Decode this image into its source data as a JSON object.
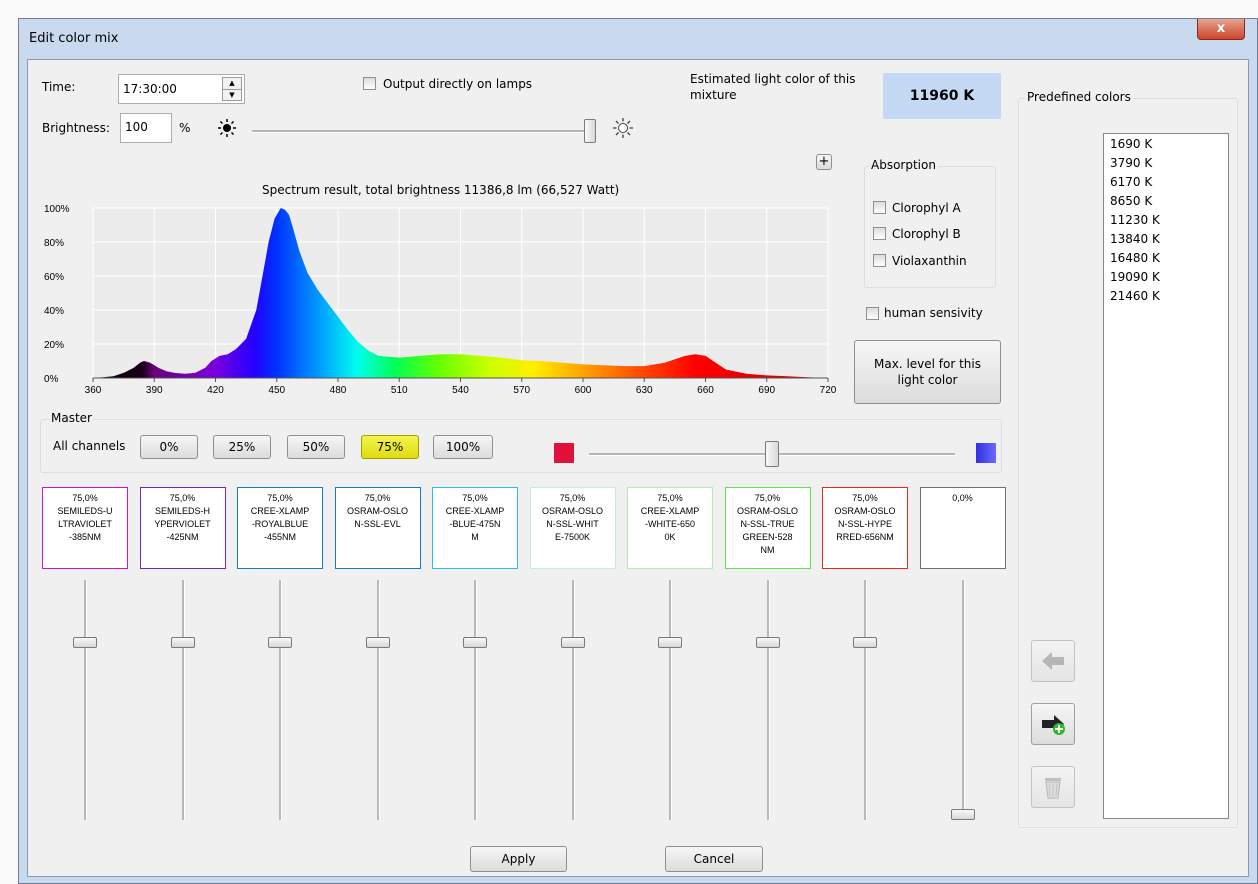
{
  "window": {
    "title": "Edit color mix",
    "close_glyph": "x"
  },
  "time": {
    "label": "Time:",
    "value": "17:30:00"
  },
  "output_lamps": {
    "label": "Output directly on lamps",
    "checked": false
  },
  "estimate": {
    "label": "Estimated light color of this mixture",
    "value": "11960 K",
    "color": "#c6d9f4"
  },
  "brightness": {
    "label": "Brightness:",
    "value": "100",
    "unit": "%",
    "slider_fraction": 1.0
  },
  "plus_label": "+",
  "chart_title": "Spectrum result, total brightness 11386,8 lm (66,527 Watt)",
  "absorption": {
    "title": "Absorption",
    "items": [
      {
        "label": "Clorophyl A",
        "checked": false
      },
      {
        "label": "Clorophyl B",
        "checked": false
      },
      {
        "label": "Violaxanthin",
        "checked": false
      }
    ]
  },
  "human_sensivity": {
    "label": "human sensivity",
    "checked": false
  },
  "max_level_button": {
    "line1": "Max. level for this",
    "line2": "light color"
  },
  "master": {
    "title": "Master",
    "all_channels_label": "All channels",
    "buttons": [
      {
        "label": "0%",
        "active": false
      },
      {
        "label": "25%",
        "active": false
      },
      {
        "label": "50%",
        "active": false
      },
      {
        "label": "75%",
        "active": true
      },
      {
        "label": "100%",
        "active": false
      }
    ],
    "slider_fraction": 0.5,
    "left_color": "#e0103a",
    "right_color": "#3030e0"
  },
  "channels": [
    {
      "value": "75,0%",
      "name_lines": [
        "SEMILEDS-U",
        "LTRAVIOLET",
        "-385NM"
      ],
      "color": "#c419c4",
      "level": 0.75
    },
    {
      "value": "75,0%",
      "name_lines": [
        "SEMILEDS-H",
        "YPERVIOLET",
        "-425NM"
      ],
      "color": "#7a1fc0",
      "level": 0.75
    },
    {
      "value": "75,0%",
      "name_lines": [
        "CREE-XLAMP",
        "-ROYALBLUE",
        "-455NM"
      ],
      "color": "#1b75cc",
      "level": 0.75
    },
    {
      "value": "75,0%",
      "name_lines": [
        "OSRAM-OSLO",
        "N-SSL-EVL"
      ],
      "color": "#1b75cc",
      "level": 0.75
    },
    {
      "value": "75,0%",
      "name_lines": [
        "CREE-XLAMP",
        "-BLUE-475N",
        "M"
      ],
      "color": "#30bde0",
      "level": 0.75
    },
    {
      "value": "75,0%",
      "name_lines": [
        "OSRAM-OSLO",
        "N-SSL-WHIT",
        "E-7500K"
      ],
      "color": "#c7ecd0",
      "level": 0.75
    },
    {
      "value": "75,0%",
      "name_lines": [
        "CREE-XLAMP",
        "-WHITE-650",
        "0K"
      ],
      "color": "#b2ecb8",
      "level": 0.75
    },
    {
      "value": "75,0%",
      "name_lines": [
        "OSRAM-OSLO",
        "N-SSL-TRUE",
        "GREEN-528",
        "NM"
      ],
      "color": "#5ee04a",
      "level": 0.75
    },
    {
      "value": "75,0%",
      "name_lines": [
        "OSRAM-OSLO",
        "N-SSL-HYPE",
        "RRED-656NM"
      ],
      "color": "#e02a1a",
      "level": 0.75
    },
    {
      "value": "0,0%",
      "name_lines": [],
      "color": "#707070",
      "level": 0.0
    }
  ],
  "predefined": {
    "title": "Predefined colors",
    "items": [
      "1690 K",
      "3790 K",
      "6170 K",
      "8650 K",
      "11230 K",
      "13840 K",
      "16480 K",
      "19090 K",
      "21460 K"
    ]
  },
  "side_icons": [
    "arrow-left-icon",
    "arrow-right-add-icon",
    "trash-icon"
  ],
  "apply_label": "Apply",
  "cancel_label": "Cancel",
  "chart_data": {
    "type": "area",
    "title": "Spectrum result, total brightness 11386,8 lm (66,527 Watt)",
    "xlabel": "",
    "ylabel": "",
    "xlim": [
      360,
      720
    ],
    "ylim": [
      0,
      100
    ],
    "x_ticks": [
      360,
      390,
      420,
      450,
      480,
      510,
      540,
      570,
      600,
      630,
      660,
      690,
      720
    ],
    "y_ticks": [
      "0%",
      "20%",
      "40%",
      "60%",
      "80%",
      "100%"
    ],
    "grid": true,
    "x": [
      360,
      365,
      370,
      375,
      380,
      383,
      385,
      388,
      392,
      396,
      400,
      405,
      410,
      415,
      418,
      422,
      426,
      430,
      435,
      440,
      443,
      446,
      449,
      452,
      454,
      456,
      458,
      461,
      465,
      470,
      475,
      480,
      485,
      490,
      495,
      500,
      510,
      520,
      530,
      540,
      550,
      560,
      570,
      580,
      590,
      600,
      610,
      620,
      630,
      640,
      645,
      650,
      655,
      660,
      665,
      670,
      680,
      690,
      700,
      710,
      720
    ],
    "y": [
      0,
      0.5,
      1,
      3,
      6,
      9,
      10,
      9,
      6,
      4,
      3,
      2.5,
      3,
      6,
      10,
      13,
      14,
      17,
      23,
      40,
      60,
      80,
      94,
      100,
      99,
      96,
      88,
      75,
      62,
      52,
      44,
      36,
      28,
      21,
      16,
      13,
      12,
      13,
      14,
      14,
      13,
      12,
      10.5,
      10,
      9,
      8,
      7.5,
      7,
      7,
      9,
      11,
      13,
      14,
      13,
      9,
      5,
      2.5,
      1.5,
      1,
      0.5,
      0
    ]
  }
}
